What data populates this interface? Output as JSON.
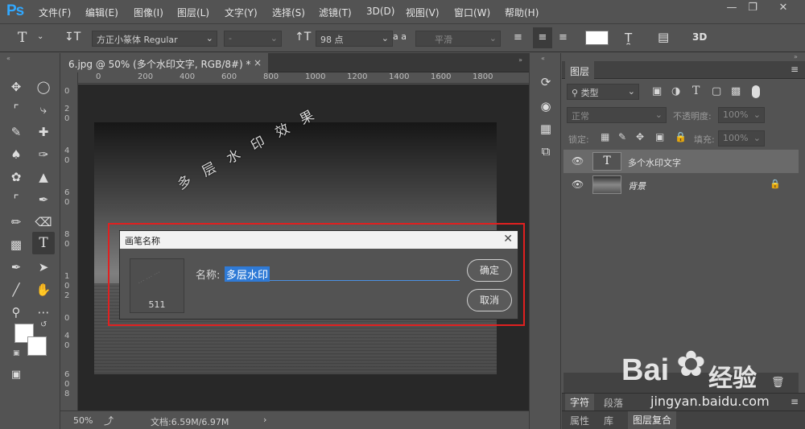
{
  "app": {
    "logo": "Ps"
  },
  "menu": [
    "文件(F)",
    "编辑(E)",
    "图像(I)",
    "图层(L)",
    "文字(Y)",
    "选择(S)",
    "滤镜(T)",
    "3D(D)",
    "视图(V)",
    "窗口(W)",
    "帮助(H)"
  ],
  "window_controls": [
    "minimize-icon",
    "restore-icon",
    "close-icon"
  ],
  "options": {
    "font_family": "方正小篆体 Regular",
    "font_style": "-",
    "font_size": "98 点",
    "anti_alias": "平滑",
    "aa_label": "a a",
    "text_color": "#ffffff"
  },
  "document": {
    "tab_title": "6.jpg @ 50% (多个水印文字, RGB/8#) *",
    "zoom": "50%",
    "doc_info": "文档:6.59M/6.97M",
    "ruler_top": [
      "0",
      "200",
      "400",
      "600",
      "800",
      "1000",
      "1200",
      "1400",
      "1600",
      "1800"
    ],
    "ruler_left": [
      "0",
      "2",
      "0",
      "4",
      "0",
      "6",
      "0",
      "8",
      "0",
      "1",
      "0",
      "2",
      "0",
      "4",
      "0",
      "6",
      "0",
      "8",
      "0"
    ],
    "canvas_watermark": "多 层 水 印 效 果"
  },
  "toolbar": {
    "tools": [
      "move-tool",
      "marquee-tool",
      "lasso-tool",
      "magic-wand-tool",
      "crop-tool",
      "eyedropper-tool",
      "healing-tool",
      "brush-tool",
      "stamp-tool",
      "history-brush-tool",
      "eraser-tool",
      "gradient-tool",
      "blur-tool",
      "dodge-tool",
      "pen-tool",
      "type-tool",
      "path-select-tool",
      "shape-tool",
      "hand-tool",
      "zoom-tool",
      "more-tools"
    ],
    "fg_color": "#ffffff",
    "bg_color": "#ffffff"
  },
  "layers_panel": {
    "tab": "图层",
    "filter_placeholder": "类型",
    "blend_mode": "正常",
    "opacity_label": "不透明度:",
    "opacity_value": "100%",
    "lock_label": "锁定:",
    "fill_label": "填充:",
    "fill_value": "100%",
    "layers": [
      {
        "name": "多个水印文字",
        "type": "text",
        "thumb": "T",
        "selected": true
      },
      {
        "name": "背景",
        "type": "image",
        "locked": true,
        "selected": false
      }
    ]
  },
  "panel_tabs_row1": [
    "字符",
    "段落"
  ],
  "panel_tabs_row2": [
    "属性",
    "库",
    "图层复合"
  ],
  "dialog": {
    "title": "画笔名称",
    "name_label": "名称:",
    "name_value": "多层水印",
    "brush_size": "511",
    "ok": "确定",
    "cancel": "取消"
  },
  "watermark": {
    "brand": "Bai",
    "brand2": "经验",
    "url": "jingyan.baidu.com"
  }
}
